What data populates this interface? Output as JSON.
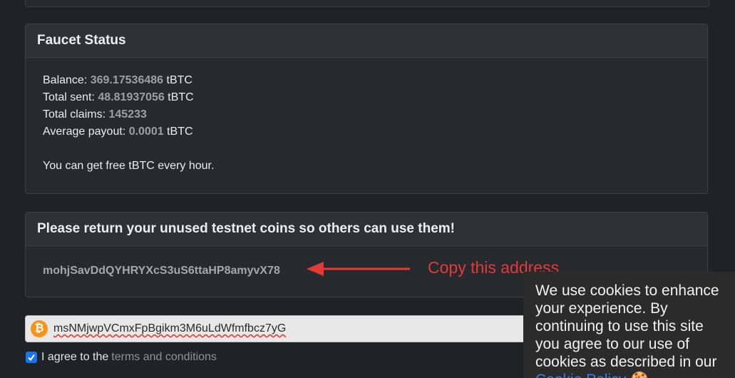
{
  "faucet_status": {
    "title": "Faucet Status",
    "balance_label": "Balance:",
    "balance_value": "369.17536486",
    "total_sent_label": "Total sent:",
    "total_sent_value": "48.81937056",
    "total_claims_label": "Total claims:",
    "total_claims_value": "145233",
    "average_payout_label": "Average payout:",
    "average_payout_value": "0.0001",
    "unit": "tBTC",
    "info_text": "You can get free tBTC every hour."
  },
  "return_card": {
    "title": "Please return your unused testnet coins so others can use them!",
    "address": "mohjSavDdQYHRYXcS3uS6ttaHP8amyvX78"
  },
  "annotation": {
    "text": "Copy this address",
    "color": "#e53935"
  },
  "address_input": {
    "value": "msNMjwpVCmxFpBgikm3M6uLdWfmfbcz7yG",
    "icon": "bitcoin-icon",
    "icon_glyph": "₿"
  },
  "agree": {
    "checked": true,
    "label": "I agree to the",
    "link": "terms and conditions"
  },
  "cookie_banner": {
    "text": "We use cookies to enhance your experience. By continuing to use this site you agree to our use of cookies as described in our",
    "link": "Cookie Policy",
    "emoji": "🍪"
  }
}
